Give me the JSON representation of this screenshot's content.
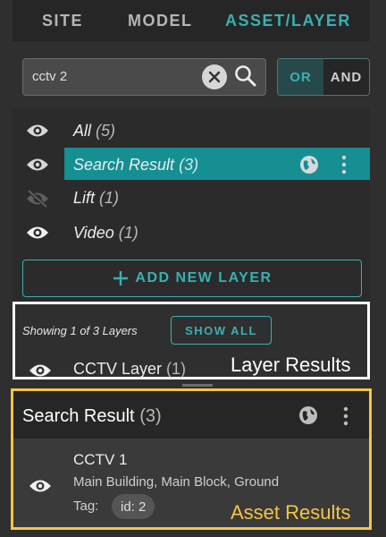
{
  "tabs": [
    {
      "label": "SITE"
    },
    {
      "label": "MODEL"
    },
    {
      "label": "ASSET/LAYER",
      "active": true
    }
  ],
  "search": {
    "value": "cctv 2",
    "mode_or": "OR",
    "mode_and": "AND",
    "active_mode": "OR"
  },
  "layers": [
    {
      "label": "All",
      "count": "(5)",
      "visible": true
    },
    {
      "label": "Search Result",
      "count": "(3)",
      "visible": true,
      "selected": true
    },
    {
      "label": "Lift",
      "count": "(1)",
      "visible": false
    },
    {
      "label": "Video",
      "count": "(1)",
      "visible": true
    }
  ],
  "add_layer_label": "ADD NEW LAYER",
  "layer_results": {
    "showing_text": "Showing 1 of 3 Layers",
    "show_all_label": "SHOW ALL",
    "layer_name": "CCTV Layer",
    "layer_count": "(1)",
    "caption": "Layer Results"
  },
  "search_result": {
    "title": "Search Result",
    "count": "(3)",
    "asset": {
      "name": "CCTV 1",
      "location": "Main Building, Main Block, Ground",
      "tag_label": "Tag:",
      "tag_value": "id: 2"
    },
    "caption": "Asset Results"
  },
  "colors": {
    "accent": "#3ab0b3",
    "selected_row": "#158f92",
    "layer_results_outline": "#ffffff",
    "asset_results_outline": "#f5c542"
  },
  "icons": [
    "eye-icon",
    "eye-off-icon",
    "globe-icon",
    "more-vert-icon",
    "search-icon",
    "close-icon",
    "plus-icon"
  ]
}
